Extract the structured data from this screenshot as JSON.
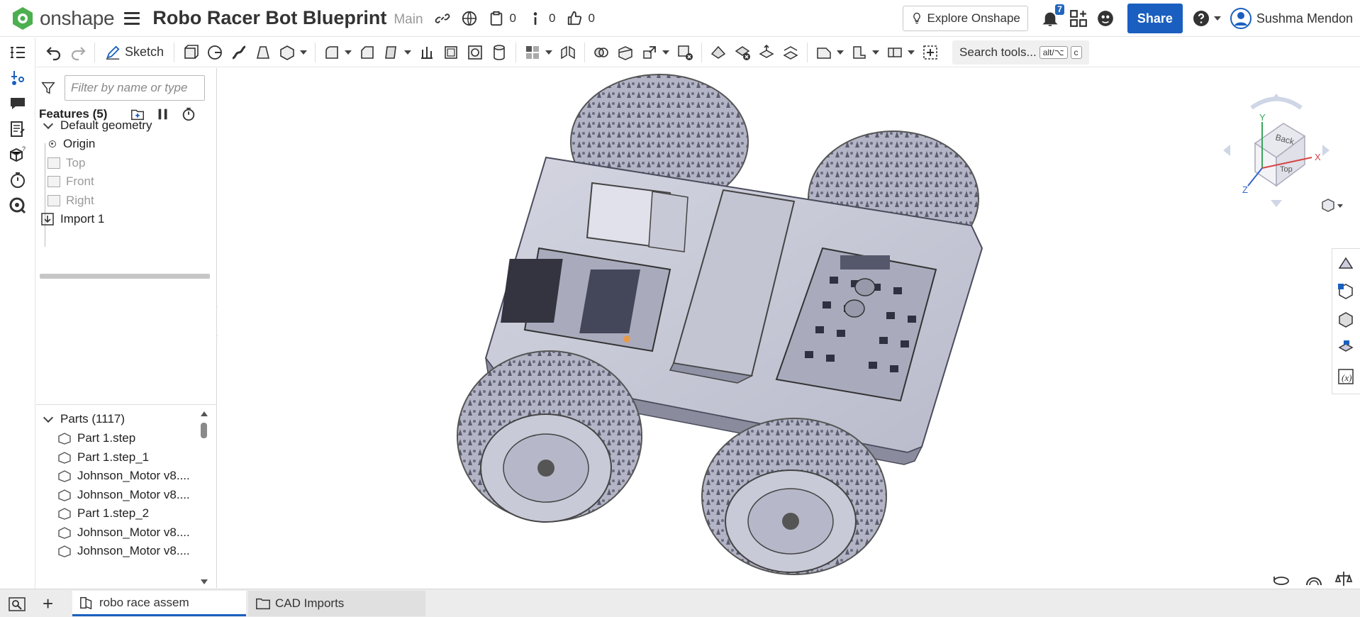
{
  "app": {
    "name": "onshape"
  },
  "document": {
    "title": "Robo Racer Bot Blueprint",
    "branch": "Main"
  },
  "topbar": {
    "version_count": "0",
    "info_count": "0",
    "like_count": "0",
    "explore_label": "Explore Onshape",
    "notification_count": "7",
    "share_label": "Share",
    "user_name": "Sushma Mendon"
  },
  "toolbar": {
    "sketch_label": "Sketch",
    "search_label": "Search tools...",
    "search_kbd_1": "alt/⌥",
    "search_kbd_2": "c"
  },
  "feature_panel": {
    "filter_placeholder": "Filter by name or type",
    "features_heading": "Features (5)",
    "default_geometry": "Default geometry",
    "origin": "Origin",
    "planes": [
      "Top",
      "Front",
      "Right"
    ],
    "import": "Import 1"
  },
  "parts": {
    "heading": "Parts (1117)",
    "items": [
      "Part 1.step",
      "Part 1.step_1",
      "Johnson_Motor v8....",
      "Johnson_Motor v8....",
      "Part 1.step_2",
      "Johnson_Motor v8....",
      "Johnson_Motor v8...."
    ]
  },
  "viewcube": {
    "face_top": "Top",
    "face_back": "Back",
    "axis_x": "X",
    "axis_y": "Y",
    "axis_z": "Z"
  },
  "tabs": [
    {
      "label": "robo race assem"
    },
    {
      "label": "CAD Imports"
    }
  ],
  "colors": {
    "accent": "#1a5fbf",
    "model": "#c9cad8",
    "model_dark": "#7d7f93"
  }
}
